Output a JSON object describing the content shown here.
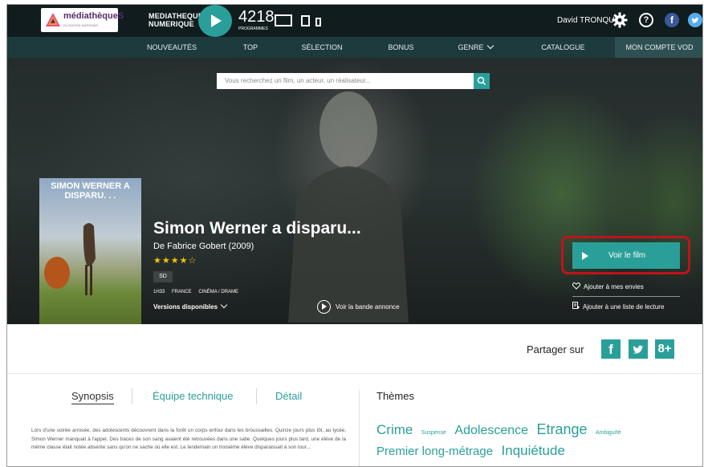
{
  "header": {
    "logo_text": "médiathèqueS",
    "logo_sub": "DU BASSIN MAREMNE",
    "brand_line1": "MEDIATHEQUE",
    "brand_line2": "NUMERIQUE",
    "programs_count": "4218",
    "programs_label": "PROGRAMMES",
    "user_name": "David TRONQUIT",
    "help_glyph": "?",
    "facebook_glyph": "f",
    "icons": [
      "logo-icon",
      "play-icon",
      "tv-icon",
      "tablet-icon",
      "phone-icon",
      "gear-icon",
      "help-icon",
      "facebook-icon",
      "twitter-icon"
    ]
  },
  "nav": {
    "items": [
      {
        "label": "NOUVEAUTÉS"
      },
      {
        "label": "TOP"
      },
      {
        "label": "SÉLECTION"
      },
      {
        "label": "BONUS"
      },
      {
        "label": "GENRE"
      },
      {
        "label": "CATALOGUE"
      },
      {
        "label": "MON COMPTE VOD",
        "active": true
      }
    ]
  },
  "search": {
    "placeholder": "Vous recherchez un film, un acteur, un réalisateur..."
  },
  "movie": {
    "poster_title": "SIMON WERNER A DISPARU. . .",
    "title": "Simon Werner a disparu...",
    "director_line": "De Fabrice Gobert (2009)",
    "stars": "★★★★☆",
    "rating": 4,
    "rating_max": 5,
    "quality": "SD",
    "duration": "1H33",
    "country": "FRANCE",
    "genre": "CINÉMA / DRAME",
    "versions_label": "Versions disponibles",
    "trailer_label": "Voir la bande annonce"
  },
  "actions": {
    "watch_label": "Voir le film",
    "wishlist_label": "Ajouter à mes envies",
    "playlist_label": "Ajouter à une liste de lecture"
  },
  "share": {
    "label": "Partager sur",
    "facebook": "f",
    "google": "8+"
  },
  "tabs": [
    {
      "label": "Synopsis",
      "active": true
    },
    {
      "label": "Équipe technique"
    },
    {
      "label": "Détail"
    }
  ],
  "synopsis": "Lors d'une soirée arrosée, des adolescents découvrent dans la forêt un corps enfoui dans les broussailles. Quinze jours plus tôt, au lycée, Simon Werner manquait à l'appel. Des traces de son sang avaient été retrouvées dans une salle. Quelques jours plus tard, une élève de la même classe était notée absente sans qu'on ne sache où elle est. Le lendemain un troisième élève disparaissait à son tour...",
  "themes": {
    "title": "Thèmes",
    "items": [
      {
        "label": "Crime",
        "size": 17
      },
      {
        "label": "Suspense",
        "size": 7
      },
      {
        "label": "Adolescence",
        "size": 16
      },
      {
        "label": "Etrange",
        "size": 18
      },
      {
        "label": "Ambiguïté",
        "size": 7
      },
      {
        "label": "Premier long-métrage",
        "size": 15
      },
      {
        "label": "Inquiétude",
        "size": 17
      }
    ]
  },
  "colors": {
    "accent": "#2a9f99",
    "topbar": "#101c1e",
    "nav": "#1d3a3c",
    "highlight_border": "#c0131b",
    "stars": "#f1c40f"
  }
}
